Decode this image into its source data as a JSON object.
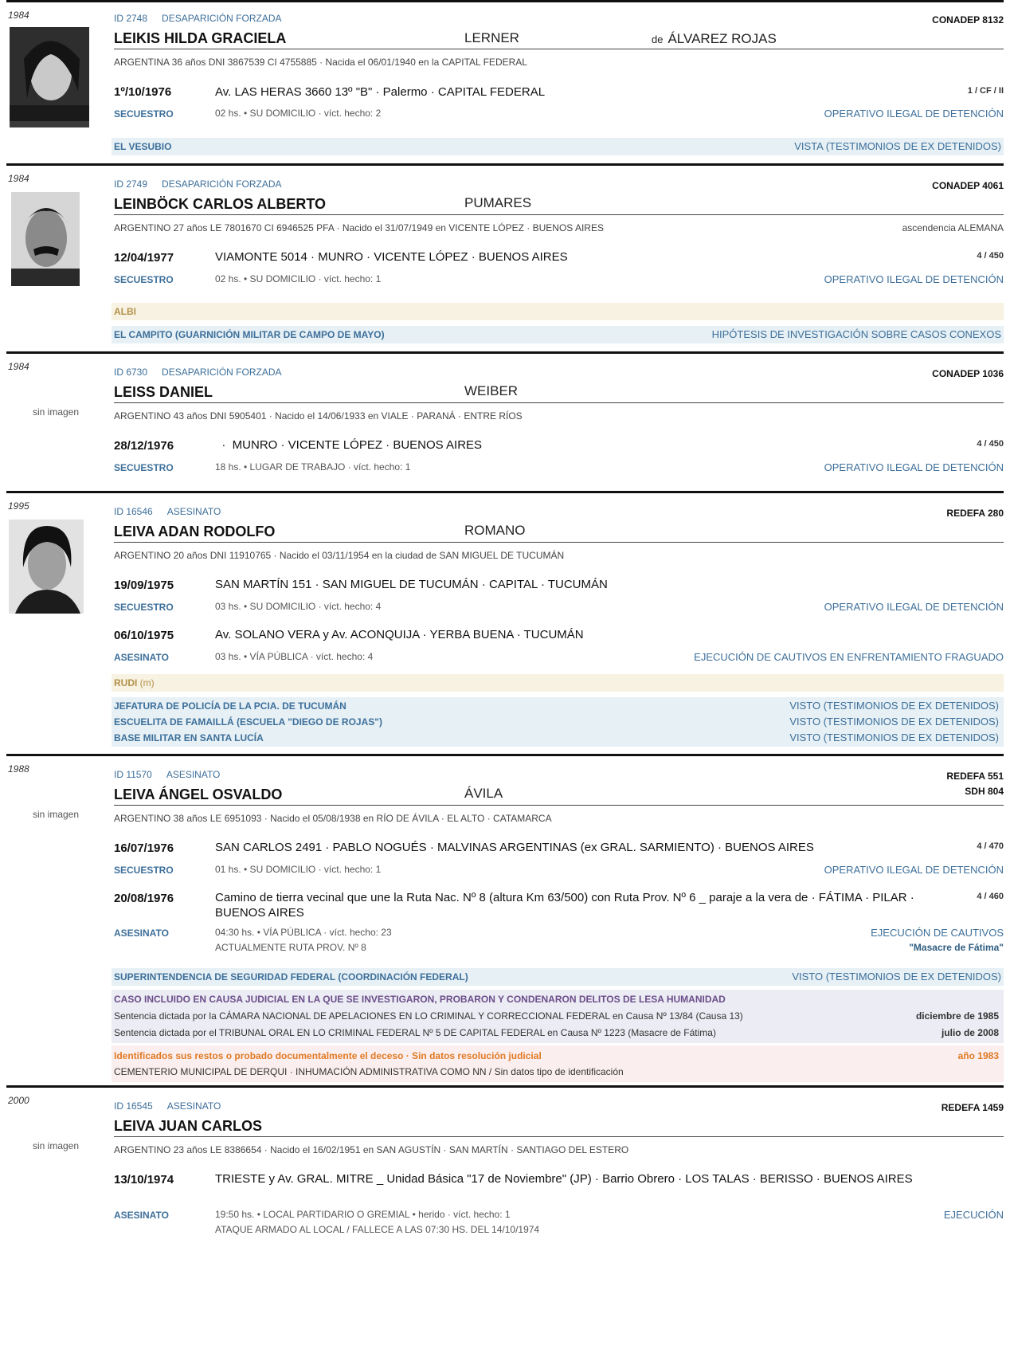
{
  "records": [
    {
      "year": "1984",
      "image": "photo-female",
      "id": "ID 2748",
      "type": "DESAPARICIÓN FORZADA",
      "code": "CONADEP  8132",
      "name": "LEIKIS  HILDA GRACIELA",
      "alias": "LERNER",
      "married_prefix": "de",
      "married": "ÁLVAREZ ROJAS",
      "info": "ARGENTINA   36 años   DNI 3867539   CI 4755885  ·  Nacida el 06/01/1940 en la CAPITAL FEDERAL",
      "date": "1º/10/1976",
      "address": "Av. LAS HERAS 3660  13º \"B\"  ·  Palermo  ·  CAPITAL FEDERAL",
      "zone": "1 / CF / II",
      "event": "SECUESTRO",
      "event_detail": "02 hs.  •  SU DOMICILIO  ·  víct. hecho: 2",
      "event_class": "OPERATIVO ILEGAL DE DETENCIÓN",
      "center": "EL VESUBIO",
      "center_src": "VISTA (TESTIMONIOS DE EX DETENIDOS)"
    },
    {
      "year": "1984",
      "image": "photo-male-mustache",
      "id": "ID 2749",
      "type": "DESAPARICIÓN FORZADA",
      "code": "CONADEP  4061",
      "name": "LEINBÖCK  CARLOS ALBERTO",
      "alias": "PUMARES",
      "info": "ARGENTINO   27 años   LE 7801670   CI 6946525 PFA  ·  Nacido el 31/07/1949 en VICENTE LÓPEZ · BUENOS AIRES",
      "info_right": "ascendencia ALEMANA",
      "date": "12/04/1977",
      "address": "VIAMONTE 5014   ·   MUNRO · VICENTE LÓPEZ · BUENOS AIRES",
      "zone": "4 / 450",
      "event": "SECUESTRO",
      "event_detail": "02 hs.  •  SU DOMICILIO  ·  víct. hecho: 1",
      "event_class": "OPERATIVO ILEGAL DE DETENCIÓN",
      "nickname": "ALBI",
      "center": "EL CAMPITO (GUARNICIÓN MILITAR DE CAMPO DE MAYO)",
      "center_src": "HIPÓTESIS DE INVESTIGACIÓN SOBRE CASOS CONEXOS"
    },
    {
      "year": "1984",
      "no_image": "sin imagen",
      "id": "ID 6730",
      "type": "DESAPARICIÓN FORZADA",
      "code": "CONADEP  1036",
      "name": "LEISS  DANIEL",
      "alias": "WEIBER",
      "info": "ARGENTINO   43 años   DNI 5905401  ·  Nacido el 14/06/1933 en VIALE · PARANÁ · ENTRE RÍOS",
      "date": "28/12/1976",
      "address": "  ·  MUNRO · VICENTE LÓPEZ · BUENOS AIRES",
      "zone": "4 / 450",
      "event": "SECUESTRO",
      "event_detail": "18 hs.  •  LUGAR DE TRABAJO  ·  víct. hecho: 1",
      "event_class": "OPERATIVO ILEGAL DE DETENCIÓN"
    },
    {
      "year": "1995",
      "image": "photo-male-young",
      "id": "ID 16546",
      "type": "ASESINATO",
      "code": "REDEFA  280",
      "name": "LEIVA  ADAN RODOLFO",
      "alias": "ROMANO",
      "info": "ARGENTINO   20 años   DNI 11910765  ·  Nacido el 03/11/1954 en la ciudad de SAN MIGUEL DE TUCUMÁN",
      "date": "19/09/1975",
      "address": "SAN MARTÍN 151   ·   SAN MIGUEL DE TUCUMÁN · CAPITAL · TUCUMÁN",
      "event": "SECUESTRO",
      "event_detail": "03 hs.  •  SU DOMICILIO  ·  víct. hecho: 4",
      "event_class": "OPERATIVO ILEGAL DE DETENCIÓN",
      "date2": "06/10/1975",
      "address2": "Av. SOLANO VERA y Av. ACONQUIJA   ·   YERBA BUENA · TUCUMÁN",
      "event2": "ASESINATO",
      "event2_detail": "03 hs.  •  VÍA PÚBLICA  ·  víct. hecho: 4",
      "event2_class": "EJECUCIÓN DE CAUTIVOS EN ENFRENTAMIENTO FRAGUADO",
      "nickname": "RUDI",
      "nickname_suffix": " (m)",
      "centers": [
        {
          "name": "JEFATURA DE POLICÍA DE LA PCIA. DE TUCUMÁN",
          "src": "VISTO (TESTIMONIOS DE EX DETENIDOS)"
        },
        {
          "name": "ESCUELITA DE FAMAILLÁ (ESCUELA \"DIEGO DE ROJAS\")",
          "src": "VISTO (TESTIMONIOS DE EX DETENIDOS)"
        },
        {
          "name": "BASE MILITAR EN SANTA LUCÍA",
          "src": "VISTO (TESTIMONIOS DE EX DETENIDOS)"
        }
      ]
    },
    {
      "year": "1988",
      "no_image": "sin imagen",
      "id": "ID 11570",
      "type": "ASESINATO",
      "code": "REDEFA  551",
      "code2": "SDH  804",
      "name": "LEIVA  ÁNGEL OSVALDO",
      "alias": "ÁVILA",
      "info": "ARGENTINO   38 años   LE 6951093  ·  Nacido el 05/08/1938 en RÍO DE ÁVILA · EL ALTO · CATAMARCA",
      "date": "16/07/1976",
      "address": "SAN CARLOS 2491   ·   PABLO NOGUÉS · MALVINAS ARGENTINAS (ex GRAL. SARMIENTO) · BUENOS AIRES",
      "zone": "4 / 470",
      "event": "SECUESTRO",
      "event_detail": "01 hs.  •  SU DOMICILIO  ·  víct. hecho: 1",
      "event_class": "OPERATIVO ILEGAL DE DETENCIÓN",
      "date2": "20/08/1976",
      "address2": "Camino de tierra vecinal que une la Ruta Nac. Nº 8 (altura Km 63/500) con Ruta Prov. Nº 6 _ paraje a la vera de   ·   FÁTIMA · PILAR · BUENOS AIRES",
      "zone2": "4 / 460",
      "event2": "ASESINATO",
      "event2_detail": "04:30 hs.  •  VÍA PÚBLICA  ·  víct. hecho: 23",
      "event2_detail2": "ACTUALMENTE RUTA PROV. Nº 8",
      "event2_class": "EJECUCIÓN DE CAUTIVOS",
      "event2_class2": "\"Masacre de Fátima\"",
      "center": "SUPERINTENDENCIA DE SEGURIDAD FEDERAL (COORDINACIÓN FEDERAL)",
      "center_src": "VISTO (TESTIMONIOS DE EX DETENIDOS)",
      "judicial_title": "CASO INCLUIDO EN CAUSA JUDICIAL EN LA QUE SE INVESTIGARON, PROBARON Y CONDENARON DELITOS DE LESA HUMANIDAD",
      "judicial": [
        {
          "text": "Sentencia dictada por la CÁMARA NACIONAL DE APELACIONES EN LO CRIMINAL Y CORRECCIONAL FEDERAL en Causa Nº 13/84 (Causa 13)",
          "date": "diciembre de 1985"
        },
        {
          "text": "Sentencia dictada por el TRIBUNAL ORAL EN LO CRIMINAL FEDERAL Nº 5 DE CAPITAL FEDERAL en Causa Nº  1223 (Masacre de Fátima)",
          "date": "julio de 2008"
        }
      ],
      "remains_title": "Identificados sus restos o probado documentalmente el deceso · Sin datos resolución judicial",
      "remains_year": "año 1983",
      "remains_text": "CEMENTERIO MUNICIPAL DE DERQUI · INHUMACIÓN ADMINISTRATIVA COMO NN  /  Sin datos tipo de identificación"
    },
    {
      "year": "2000",
      "no_image": "sin imagen",
      "id": "ID 16545",
      "type": "ASESINATO",
      "code": "REDEFA  1459",
      "name": "LEIVA  JUAN CARLOS",
      "info": "ARGENTINO   23 años   LE 8386654  ·  Nacido el 16/02/1951 en SAN AGUSTÍN · SAN MARTÍN · SANTIAGO DEL ESTERO",
      "date": "13/10/1974",
      "address": "TRIESTE y Av. GRAL. MITRE _ Unidad Básica \"17 de Noviembre\" (JP)  ·  Barrio Obrero  ·  LOS TALAS · BERISSO · BUENOS AIRES",
      "event": "ASESINATO",
      "event_detail": "19:50 hs.  •  LOCAL PARTIDARIO O GREMIAL  •  herido  ·  víct. hecho: 1",
      "event_detail2": "ATAQUE ARMADO AL LOCAL / FALLECE A LAS 07:30 HS. DEL 14/10/1974",
      "event_class": "EJECUCIÓN"
    }
  ]
}
